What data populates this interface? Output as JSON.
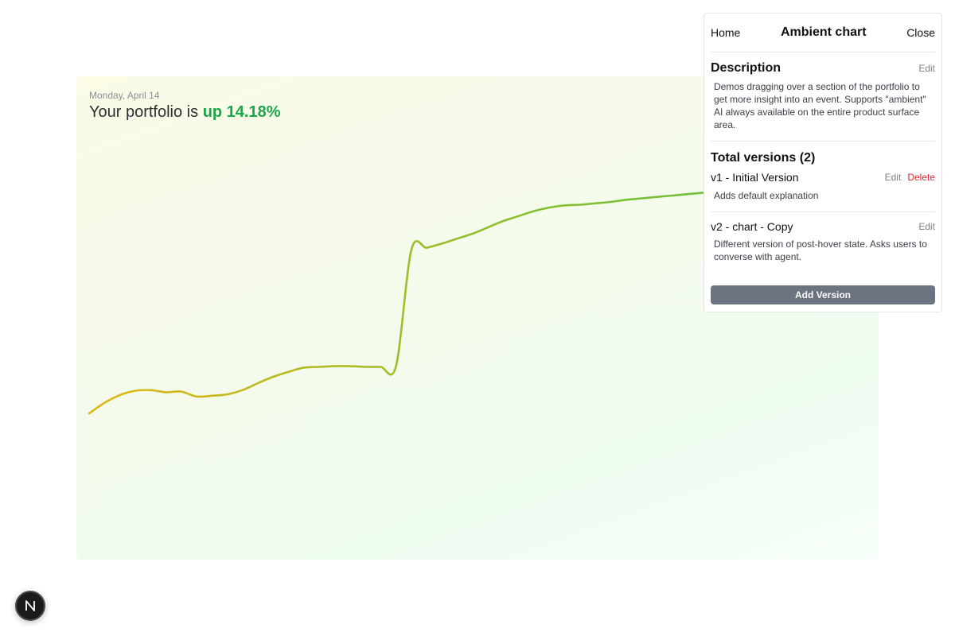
{
  "chart": {
    "date": "Monday, April 14",
    "headline_prefix": "Your portfolio is ",
    "headline_change": "up 14.18%"
  },
  "panel": {
    "home_label": "Home",
    "title": "Ambient chart",
    "close_label": "Close",
    "description": {
      "heading": "Description",
      "edit_label": "Edit",
      "text": "Demos dragging over a section of the portfolio to get more insight into an event. Supports \"ambient\" AI always available on the entire product surface area."
    },
    "versions": {
      "heading": "Total versions (2)",
      "items": [
        {
          "name": "v1 - Initial Version",
          "edit_label": "Edit",
          "delete_label": "Delete",
          "description": "Adds default explanation"
        },
        {
          "name": "v2 - chart - Copy",
          "edit_label": "Edit",
          "description": "Different version of post-hover state. Asks users to converse with agent."
        }
      ]
    },
    "add_version_label": "Add Version"
  },
  "badge": {
    "letter": "N",
    "icon": "nextjs-logo-icon"
  },
  "colors": {
    "gain": "#1aa74a",
    "line_start": "#e2b514",
    "line_end": "#5cc241",
    "delete": "#e0242f",
    "button": "#6b7280"
  },
  "chart_data": {
    "type": "line",
    "title": "",
    "xlabel": "",
    "ylabel": "",
    "x": [
      0,
      1,
      2,
      3,
      4,
      5,
      6,
      7,
      8,
      9,
      10,
      11,
      12,
      13,
      14,
      15,
      16,
      17,
      18,
      19,
      20,
      21,
      22,
      23,
      24,
      25,
      26,
      27,
      28,
      29,
      30,
      31,
      32,
      33,
      34,
      35,
      36,
      37,
      38,
      39,
      40,
      41,
      42,
      43,
      44,
      45,
      46,
      47,
      48,
      49,
      50
    ],
    "series": [
      {
        "values": [
          0,
          1.5,
          2.6,
          3.2,
          3.3,
          3.0,
          3.1,
          2.4,
          2.5,
          2.7,
          3.3,
          4.3,
          5.2,
          5.9,
          6.5,
          6.6,
          6.7,
          6.7,
          6.6,
          6.6,
          6.7,
          23.2,
          23.5,
          24.1,
          24.8,
          25.5,
          26.4,
          27.3,
          28.0,
          28.7,
          29.2,
          29.5,
          29.6,
          29.8,
          30.0,
          30.3,
          30.5,
          30.7,
          30.9,
          31.1,
          31.3,
          31.5,
          31.6,
          31.8,
          31.9,
          32.1,
          32.2,
          32.4,
          32.5,
          32.6,
          32.7
        ]
      }
    ],
    "grid": false,
    "legend": "none"
  }
}
